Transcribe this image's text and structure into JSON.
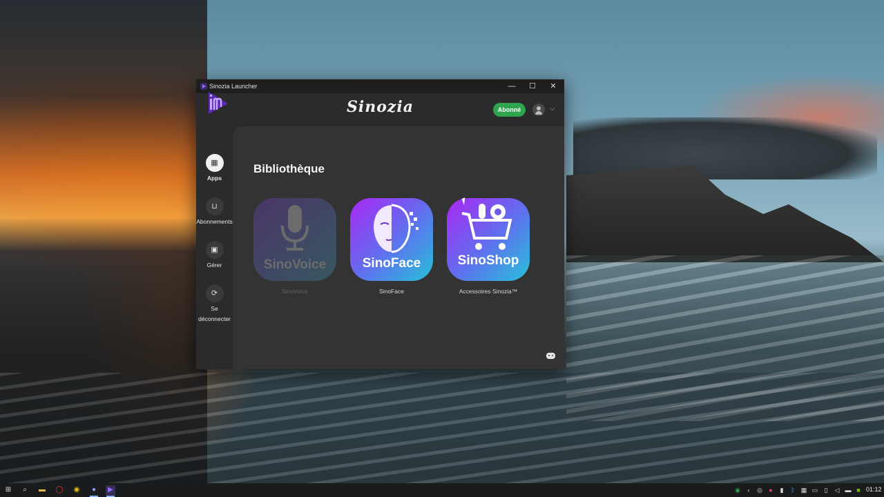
{
  "window": {
    "title": "Sinozia Launcher",
    "controls": {
      "minimize": "—",
      "maximize": "☐",
      "close": "✕"
    }
  },
  "header": {
    "brand": "Sinozia",
    "subscription_badge": "Abonné",
    "badge_color": "#2ea44f",
    "accent_color": "#7b3fe4"
  },
  "sidebar": {
    "items": [
      {
        "label": "Apps",
        "icon": "grid-icon",
        "glyph": "▦",
        "active": true
      },
      {
        "label": "Abonnements",
        "icon": "cart-icon",
        "glyph": "🛒",
        "active": false
      },
      {
        "label": "Gérer",
        "icon": "wallet-icon",
        "glyph": "▣",
        "active": false
      },
      {
        "label": "Se",
        "label2": "déconnecter",
        "icon": "logout-icon",
        "glyph": "⟳",
        "active": false
      }
    ]
  },
  "main": {
    "title": "Bibliothèque",
    "apps": [
      {
        "tile_text": "SinoVoice",
        "label": "SinoVoice",
        "icon": "microphone-icon",
        "enabled": false
      },
      {
        "tile_text": "SinoFace",
        "label": "SinoFace",
        "icon": "face-icon",
        "enabled": true
      },
      {
        "tile_text": "SinoShop",
        "label": "Accessoires Sinozia™",
        "icon": "shopping-cart-icon",
        "enabled": true
      }
    ]
  },
  "taskbar": {
    "clock": "01:12",
    "apps": [
      "windows-start-icon",
      "search-icon",
      "file-explorer-icon",
      "opera-icon",
      "chrome-icon",
      "discord-icon",
      "sinozia-launcher-icon"
    ]
  }
}
